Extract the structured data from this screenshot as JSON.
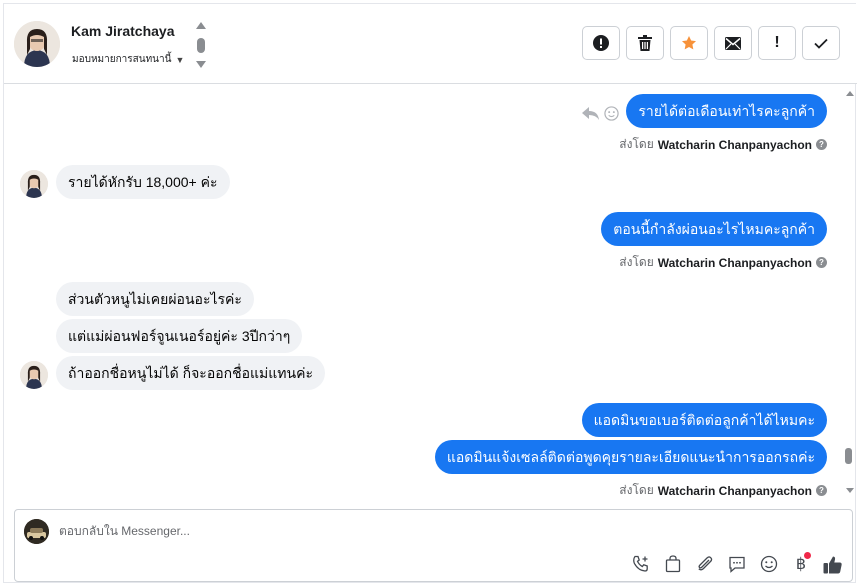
{
  "header": {
    "contact_name": "Kam Jiratchaya",
    "assign_label": "มอบหมายการสนทนานี้",
    "actions": [
      {
        "name": "important-button",
        "icon": "exclamation-circle-icon"
      },
      {
        "name": "delete-button",
        "icon": "trash-icon"
      },
      {
        "name": "star-button",
        "icon": "star-icon"
      },
      {
        "name": "mark-unread-button",
        "icon": "envelope-icon"
      },
      {
        "name": "spam-button",
        "icon": "exclamation-icon"
      },
      {
        "name": "done-button",
        "icon": "check-icon"
      }
    ]
  },
  "messages": {
    "m1": "รายได้ต่อเดือนเท่าไรคะลูกค้า",
    "m2": "รายได้หักรับ 18,000+ ค่ะ",
    "m3": "ตอนนี้กำลังผ่อนอะไรไหมคะลูกค้า",
    "m4": "ส่วนตัวหนูไม่เคยผ่อนอะไรค่ะ",
    "m5": "แต่แม่ผ่อนฟอร์จูนเนอร์อยู่ค่ะ 3ปีกว่าๆ",
    "m6": "ถ้าออกชื่อหนูไม่ได้ ก็จะออกชื่อแม่แทนค่ะ",
    "m7": "แอดมินขอเบอร์ติดต่อลูกค้าได้ไหมคะ",
    "m8": "แอดมินแจ้งเซลล์ติดต่อพูดคุยรายละเอียดแนะนำการออกรถค่ะ"
  },
  "sent_by": {
    "prefix": "ส่งโดย",
    "agent": "Watcharin Chanpanyachon"
  },
  "composer": {
    "placeholder": "ตอบกลับใน Messenger...",
    "tools": [
      "phone-plus-icon",
      "shopping-bag-icon",
      "paperclip-icon",
      "saved-reply-icon",
      "emoji-icon",
      "baht-icon",
      "like-icon"
    ]
  },
  "colors": {
    "outgoing": "#1877f2",
    "incoming": "#f0f2f5",
    "star": "#f7923a"
  }
}
